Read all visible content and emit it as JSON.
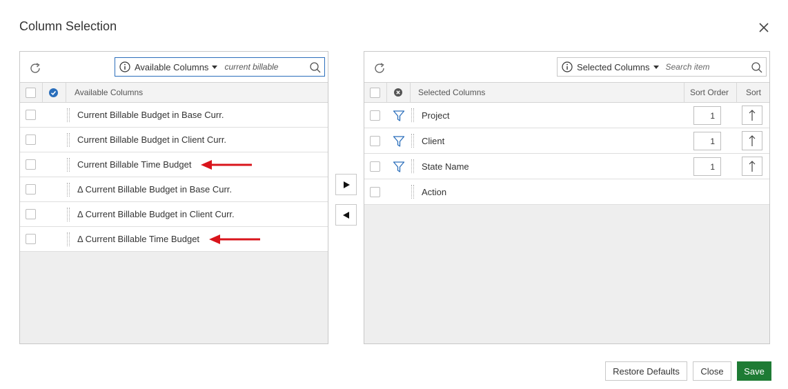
{
  "dialog": {
    "title": "Column Selection"
  },
  "available": {
    "dropdown_label": "Available Columns",
    "search_value": "current billable",
    "header_label": "Available Columns",
    "rows": [
      {
        "label": "Current Billable Budget in Base Curr.",
        "marked": false
      },
      {
        "label": "Current Billable Budget in Client Curr.",
        "marked": false
      },
      {
        "label": "Current Billable Time Budget",
        "marked": true
      },
      {
        "label": "Δ Current Billable Budget in Base Curr.",
        "marked": false
      },
      {
        "label": "Δ Current Billable Budget in Client Curr.",
        "marked": false
      },
      {
        "label": "Δ Current Billable Time Budget",
        "marked": true
      }
    ]
  },
  "selected": {
    "dropdown_label": "Selected Columns",
    "search_placeholder": "Search item",
    "header_label": "Selected Columns",
    "header_sort_order": "Sort Order",
    "header_sort": "Sort",
    "rows": [
      {
        "label": "Project",
        "sort_order": "1",
        "has_filter": true
      },
      {
        "label": "Client",
        "sort_order": "1",
        "has_filter": true
      },
      {
        "label": "State Name",
        "sort_order": "1",
        "has_filter": true
      },
      {
        "label": "Action",
        "sort_order": "",
        "has_filter": false
      }
    ]
  },
  "footer": {
    "restore_label": "Restore Defaults",
    "close_label": "Close",
    "save_label": "Save"
  },
  "colors": {
    "accent": "#2a6ebb",
    "save_green": "#1e7b34",
    "annotation_red": "#d9141b"
  }
}
